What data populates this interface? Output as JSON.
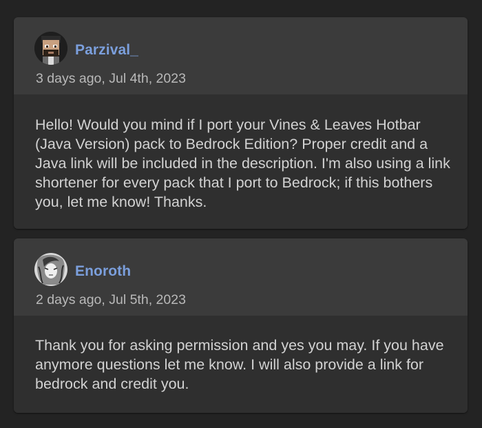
{
  "comments": [
    {
      "username": "Parzival_",
      "timestamp": "3 days ago, Jul 4th, 2023",
      "avatar_icon": "pixel-skin-avatar-icon",
      "text": "Hello! Would you mind if I port your Vines & Leaves Hotbar (Java Version) pack to Bedrock Edition? Proper credit and a Java link will be included in the description. I'm also using a link shortener for every pack that I port to Bedrock; if this bothers you, let me know! Thanks."
    },
    {
      "username": "Enoroth",
      "timestamp": "2 days ago, Jul 5th, 2023",
      "avatar_icon": "sketch-portrait-avatar-icon",
      "text": "Thank you for asking permission and yes you may. If you have anymore questions let me know. I will also provide a link for bedrock and credit you."
    }
  ],
  "colors": {
    "page_background": "#232323",
    "header_background": "#3b3b3b",
    "body_background": "#2f2f2f",
    "username": "#7b9fdc",
    "timestamp": "#b9b9b9",
    "text": "#d2d2d2"
  }
}
